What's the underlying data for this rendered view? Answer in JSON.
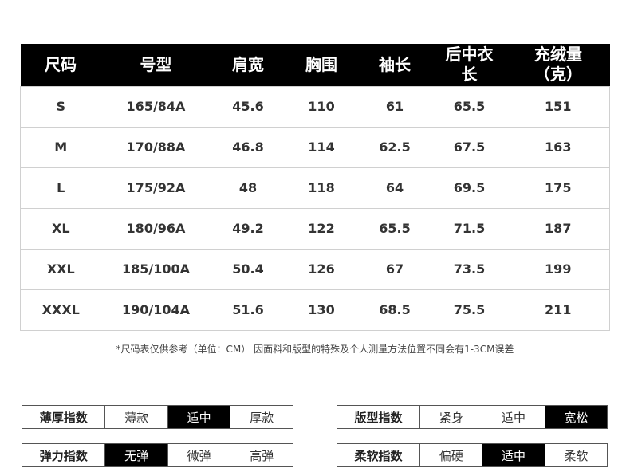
{
  "size_table": {
    "headers": [
      "尺码",
      "号型",
      "肩宽",
      "胸围",
      "袖长",
      "后中衣长",
      "充绒量（克）"
    ],
    "header_lines": [
      [
        "尺码"
      ],
      [
        "号型"
      ],
      [
        "肩宽"
      ],
      [
        "胸围"
      ],
      [
        "袖长"
      ],
      [
        "后中衣",
        "长"
      ],
      [
        "充绒量",
        "（克）"
      ]
    ],
    "rows": [
      [
        "S",
        "165/84A",
        "45.6",
        "110",
        "61",
        "65.5",
        "151"
      ],
      [
        "M",
        "170/88A",
        "46.8",
        "114",
        "62.5",
        "67.5",
        "163"
      ],
      [
        "L",
        "175/92A",
        "48",
        "118",
        "64",
        "69.5",
        "175"
      ],
      [
        "XL",
        "180/96A",
        "49.2",
        "122",
        "65.5",
        "71.5",
        "187"
      ],
      [
        "XXL",
        "185/100A",
        "50.4",
        "126",
        "67",
        "73.5",
        "199"
      ],
      [
        "XXXL",
        "190/104A",
        "51.6",
        "130",
        "68.5",
        "75.5",
        "211"
      ]
    ]
  },
  "note": "*尺码表仅供参考（单位：CM） 因面料和版型的特殊及个人测量方法位置不同会有1-3CM误差",
  "indices": {
    "thickness": {
      "title": "薄厚指数",
      "options": [
        "薄款",
        "适中",
        "厚款"
      ],
      "selected": "适中"
    },
    "fit": {
      "title": "版型指数",
      "options": [
        "紧身",
        "适中",
        "宽松"
      ],
      "selected": "宽松"
    },
    "elastic": {
      "title": "弹力指数",
      "options": [
        "无弹",
        "微弹",
        "高弹"
      ],
      "selected": "无弹"
    },
    "softness": {
      "title": "柔软指数",
      "options": [
        "偏硬",
        "适中",
        "柔软"
      ],
      "selected": "适中"
    }
  },
  "colors": {
    "header_bg": "#000000",
    "header_text": "#ffffff",
    "selected_bg": "#000000",
    "border": "#d0d0d0"
  }
}
